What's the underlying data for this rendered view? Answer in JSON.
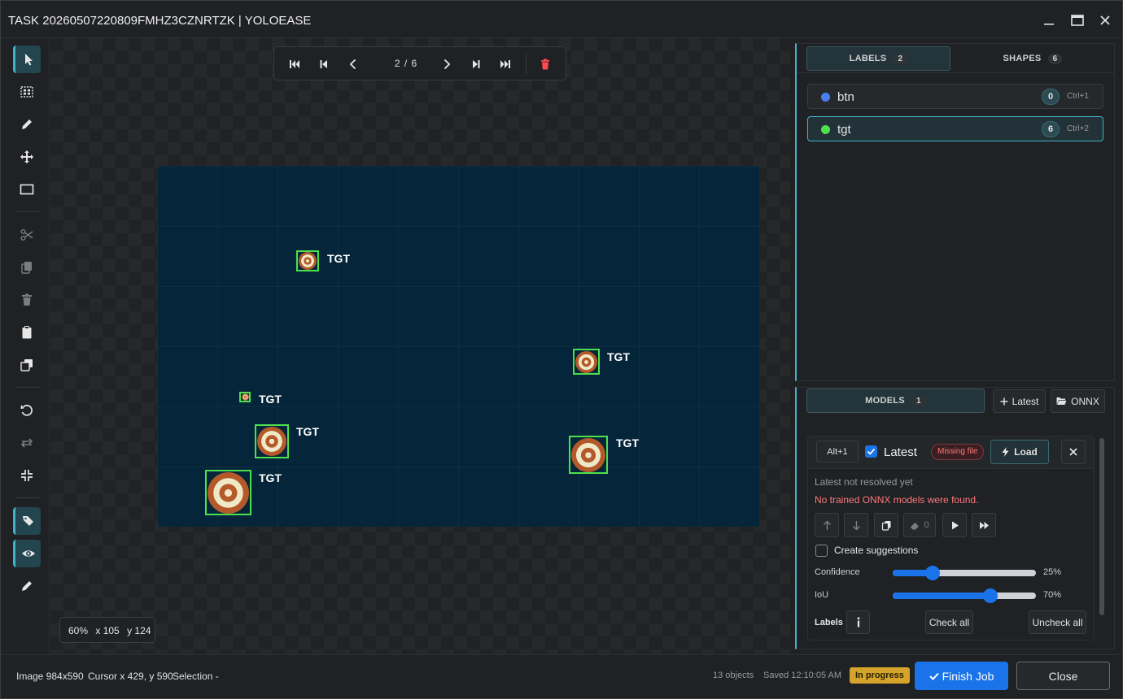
{
  "window": {
    "title": "TASK 20260507220809FMHZ3CZNRTZK | YOLOEASE"
  },
  "toolbar": {
    "tools": [
      "select-icon",
      "box-select-icon",
      "pencil-icon",
      "move-icon",
      "rectangle-icon",
      "scissors-icon",
      "copy-icon",
      "trash-icon",
      "clipboard-icon",
      "duplicate-icon",
      "undo-icon",
      "redo-icon",
      "fit-icon",
      "tag-icon",
      "eye-icon",
      "ruler-icon"
    ]
  },
  "nav": {
    "page_indicator": "2 / 6"
  },
  "canvas": {
    "boxes": [
      {
        "label": "TGT"
      },
      {
        "label": "TGT"
      },
      {
        "label": "TGT"
      },
      {
        "label": "TGT"
      },
      {
        "label": "TGT"
      },
      {
        "label": "TGT"
      }
    ],
    "zoom": "60%",
    "x": "x 105",
    "y": "y 124"
  },
  "labels_panel": {
    "tabs": [
      {
        "label": "LABELS",
        "count": "2"
      },
      {
        "label": "SHAPES",
        "count": "6"
      }
    ],
    "items": [
      {
        "name": "btn",
        "count": "0",
        "shortcut": "Ctrl+1",
        "color": "#4a7ef0"
      },
      {
        "name": "tgt",
        "count": "6",
        "shortcut": "Ctrl+2",
        "color": "#4de04d"
      }
    ]
  },
  "models_panel": {
    "tab_label": "MODELS",
    "tab_count": "1",
    "latest_button": "Latest",
    "onnx_button": "ONNX",
    "model": {
      "shortcut": "Alt+1",
      "name": "Latest",
      "badge": "Missing file",
      "load_button": "Load",
      "status": "Latest not resolved yet",
      "error": "No trained ONNX models were found.",
      "eraser_count": "0",
      "create_suggestions": "Create suggestions",
      "confidence_label": "Confidence",
      "confidence_value": "25%",
      "confidence": 0.25,
      "iou_label": "IoU",
      "iou_value": "70%",
      "iou": 0.7,
      "labels_label": "Labels",
      "check_all": "Check all",
      "uncheck_all": "Uncheck all"
    }
  },
  "status": {
    "image": "Image 984x590",
    "cursor": "Cursor x 429, y 590",
    "selection": "Selection -",
    "objects": "13 objects",
    "saved": "Saved 12:10:05 AM",
    "badge": "In progress",
    "finish": "Finish Job",
    "close": "Close"
  }
}
